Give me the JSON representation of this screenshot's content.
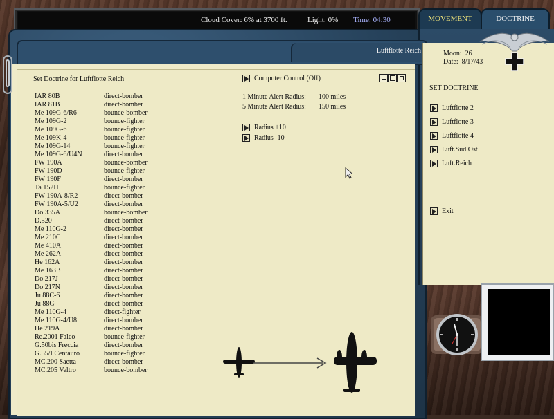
{
  "status_bar": {
    "cloud_cover": "Cloud Cover:  6% at 3700 ft.",
    "light": "Light:  0%",
    "time": "Time: 04:30"
  },
  "tabs": {
    "movement": "MOVEMENT",
    "doctrine": "DOCTRINE"
  },
  "folder_title": "Luftflotte Reich",
  "panel": {
    "title": "Set Doctrine for Luftflotte Reich",
    "computer_control": "Computer Control (Off)"
  },
  "aircraft": [
    {
      "name": "IAR 80B",
      "doctrine": "direct-bomber"
    },
    {
      "name": "IAR 81B",
      "doctrine": "direct-bomber"
    },
    {
      "name": "Me 109G-6/R6",
      "doctrine": "bounce-bomber"
    },
    {
      "name": "Me 109G-2",
      "doctrine": "bounce-fighter"
    },
    {
      "name": "Me 109G-6",
      "doctrine": "bounce-fighter"
    },
    {
      "name": "Me 109K-4",
      "doctrine": "bounce-fighter"
    },
    {
      "name": "Me 109G-14",
      "doctrine": "bounce-fighter"
    },
    {
      "name": "Me 109G-6/U4N",
      "doctrine": "direct-bomber"
    },
    {
      "name": "FW 190A",
      "doctrine": "bounce-bomber"
    },
    {
      "name": "FW 190D",
      "doctrine": "bounce-fighter"
    },
    {
      "name": "FW 190F",
      "doctrine": "direct-bomber"
    },
    {
      "name": "Ta 152H",
      "doctrine": "bounce-fighter"
    },
    {
      "name": "FW 190A-8/R2",
      "doctrine": "direct-bomber"
    },
    {
      "name": "FW 190A-5/U2",
      "doctrine": "direct-bomber"
    },
    {
      "name": "Do 335A",
      "doctrine": "bounce-bomber"
    },
    {
      "name": "D.520",
      "doctrine": "direct-bomber"
    },
    {
      "name": "Me 110G-2",
      "doctrine": "direct-bomber"
    },
    {
      "name": "Me 210C",
      "doctrine": "direct-bomber"
    },
    {
      "name": "Me 410A",
      "doctrine": "direct-bomber"
    },
    {
      "name": "Me 262A",
      "doctrine": "direct-bomber"
    },
    {
      "name": "He 162A",
      "doctrine": "direct-bomber"
    },
    {
      "name": "Me 163B",
      "doctrine": "direct-bomber"
    },
    {
      "name": "Do 217J",
      "doctrine": "direct-bomber"
    },
    {
      "name": "Do 217N",
      "doctrine": "direct-bomber"
    },
    {
      "name": "Ju 88C-6",
      "doctrine": "direct-bomber"
    },
    {
      "name": "Ju 88G",
      "doctrine": "direct-bomber"
    },
    {
      "name": "Me 110G-4",
      "doctrine": "direct-fighter"
    },
    {
      "name": "Me 110G-4/U8",
      "doctrine": "direct-bomber"
    },
    {
      "name": "He 219A",
      "doctrine": "direct-bomber"
    },
    {
      "name": "Re.2001 Falco",
      "doctrine": "bounce-fighter"
    },
    {
      "name": "G.50bis Freccia",
      "doctrine": "direct-bomber"
    },
    {
      "name": "G.55/I Centauro",
      "doctrine": "bounce-fighter"
    },
    {
      "name": "MC.200 Saetta",
      "doctrine": "direct-bomber"
    },
    {
      "name": "MC.205 Veltro",
      "doctrine": "bounce-bomber"
    }
  ],
  "alert": {
    "one_min_label": "1 Minute Alert Radius:",
    "one_min_value": "100 miles",
    "five_min_label": "5 Minute Alert Radius:",
    "five_min_value": "150 miles"
  },
  "radius_buttons": {
    "plus": "Radius +10",
    "minus": "Radius -10"
  },
  "info": {
    "moon_label": "Moon:",
    "moon_value": "26",
    "date_label": "Date:",
    "date_value": "8/17/43"
  },
  "set_doctrine_heading": "SET DOCTRINE",
  "doctrine_buttons": [
    "Luftflotte 2",
    "Luftflotte 3",
    "Luftflotte 4",
    "Luft.Sud Ost",
    "Luft.Reich"
  ],
  "exit_label": "Exit"
}
